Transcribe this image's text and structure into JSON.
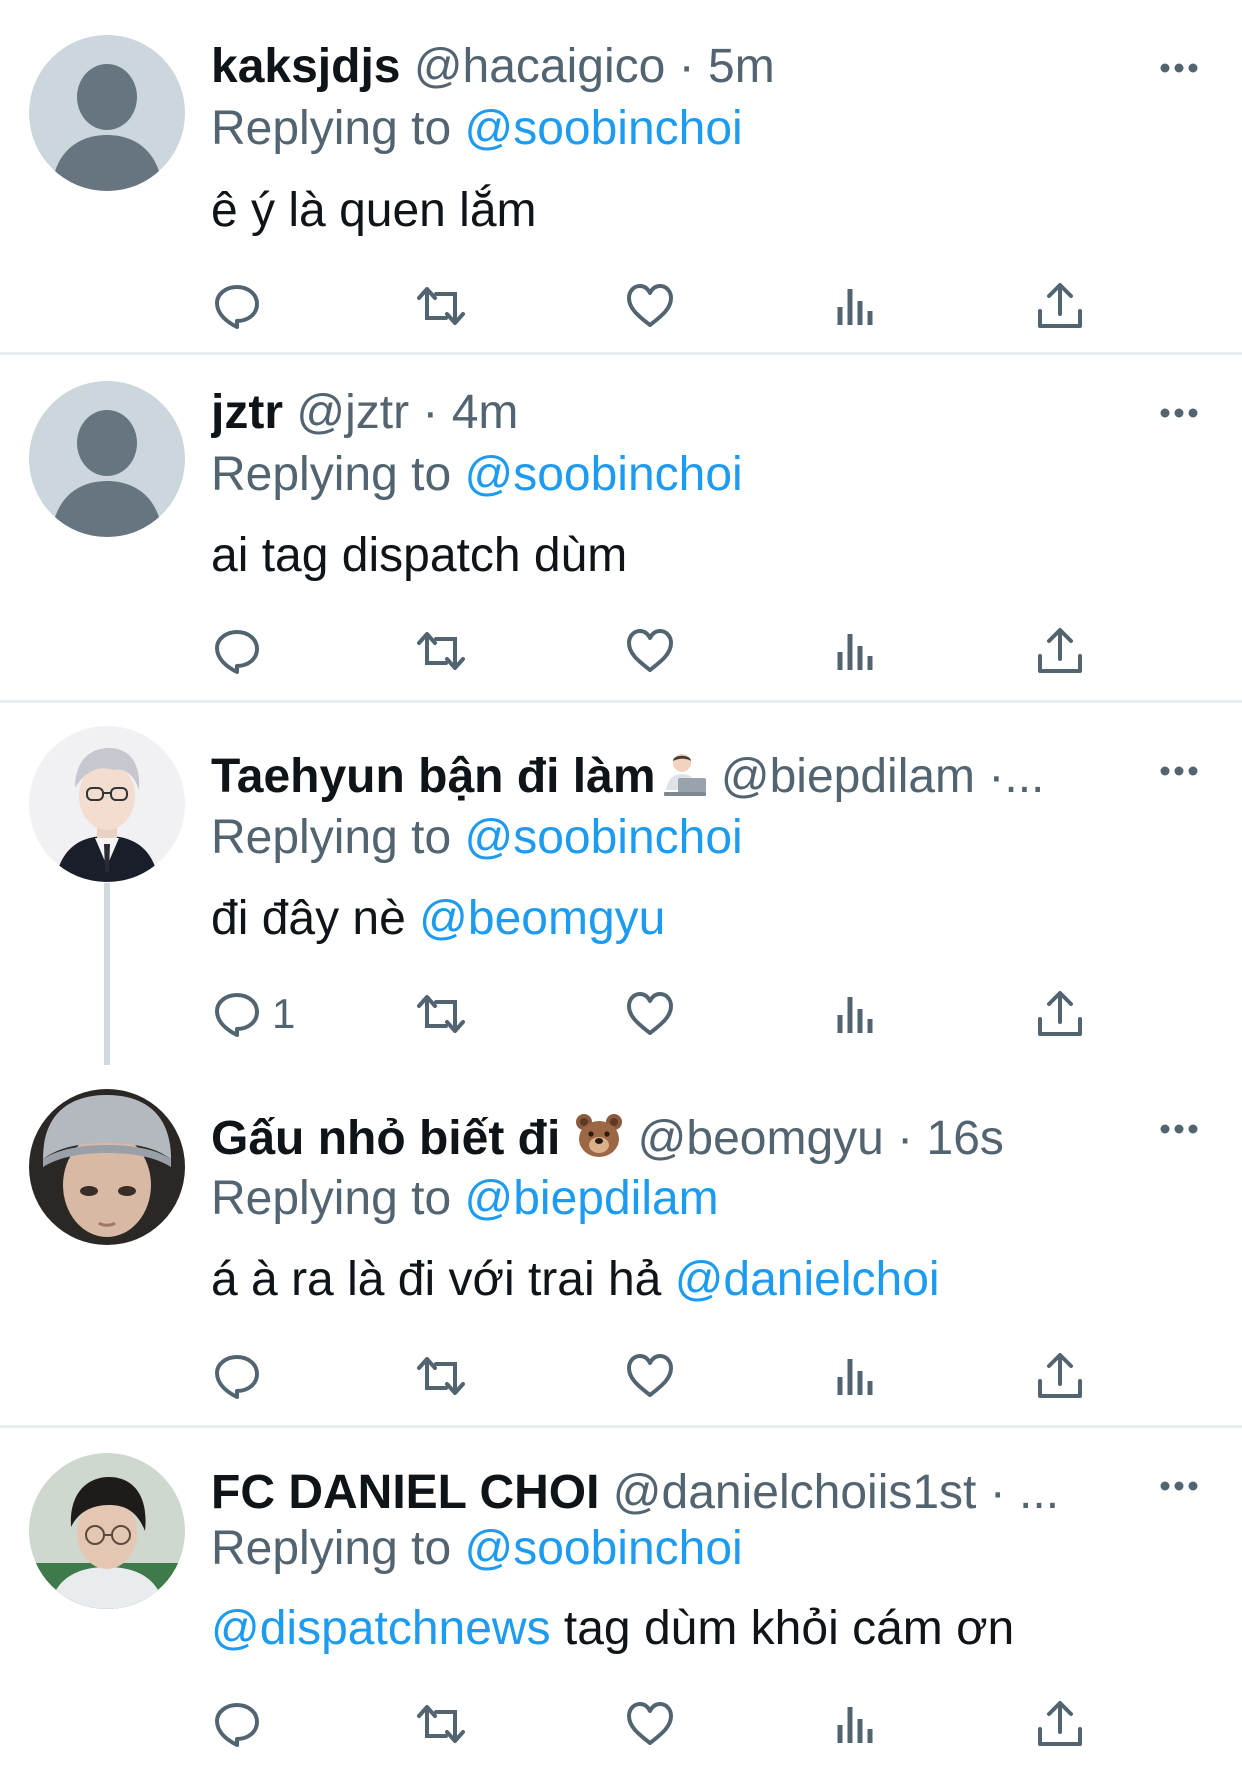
{
  "tweets": [
    {
      "display_name": "kaksjdjs",
      "handle": "@hacaigico",
      "sep": " · ",
      "time": "5m",
      "ellipsis": "",
      "reply_prefix": "Replying to ",
      "reply_to": "@soobinchoi",
      "text": "ê ý là quen lắm",
      "text_mention": "",
      "lead_mention": "",
      "reply_count": "",
      "avatar": "default-avatar"
    },
    {
      "display_name": "jztr",
      "handle": "@jztr",
      "sep": " · ",
      "time": "4m",
      "ellipsis": "",
      "reply_prefix": "Replying to ",
      "reply_to": "@soobinchoi",
      "text": "ai tag dispatch dùm",
      "text_mention": "",
      "lead_mention": "",
      "reply_count": "",
      "avatar": "default-avatar"
    },
    {
      "display_name": "Taehyun bận đi làm",
      "handle": "@biepdilam",
      "sep": " ·",
      "time": "",
      "ellipsis": "...",
      "reply_prefix": "Replying to ",
      "reply_to": "@soobinchoi",
      "text": "đi đây nè ",
      "text_mention": "@beomgyu",
      "lead_mention": "",
      "reply_count": "1",
      "avatar": "photo-avatar"
    },
    {
      "display_name": "Gấu nhỏ biết đi",
      "handle": "@beomgyu",
      "sep": " · ",
      "time": "16s",
      "ellipsis": "",
      "reply_prefix": "Replying to ",
      "reply_to": "@biepdilam",
      "text": "á à ra là đi với trai hả ",
      "text_mention": "@danielchoi",
      "lead_mention": "",
      "reply_count": "",
      "avatar": "photo-avatar"
    },
    {
      "display_name": "FC DANIEL CHOI",
      "handle": "@danielchoiis1st",
      "sep": " · ",
      "time": "",
      "ellipsis": "...",
      "reply_prefix": "Replying to ",
      "reply_to": "@soobinchoi",
      "text": " tag dùm khỏi cám ơn",
      "text_mention": "",
      "lead_mention": "@dispatchnews",
      "reply_count": "",
      "avatar": "photo-avatar"
    }
  ],
  "icons": {
    "more": "more-horizontal-icon",
    "reply": "reply-icon",
    "retweet": "retweet-icon",
    "like": "like-icon",
    "views": "views-icon",
    "share": "share-icon",
    "emoji_tweet3": "technologist-emoji-icon",
    "emoji_tweet4": "bear-emoji-icon"
  },
  "colors": {
    "text": "#0f1419",
    "secondary": "#536471",
    "accent": "#1d9bf0",
    "divider": "#e6ecf0"
  }
}
